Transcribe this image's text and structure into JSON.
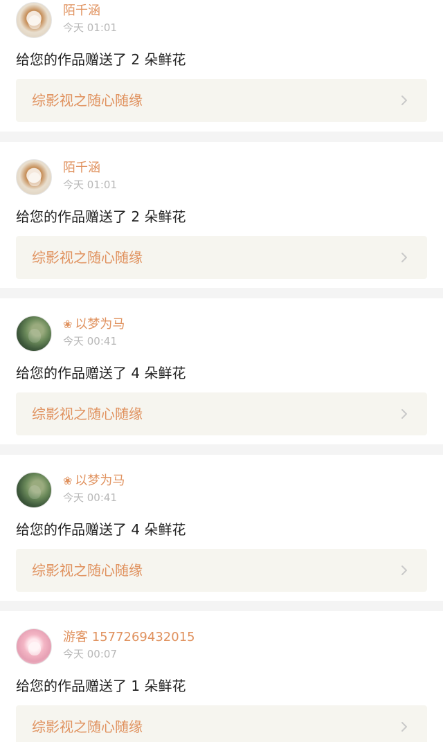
{
  "notifications": [
    {
      "user": "陌千涵",
      "vip": false,
      "time": "今天 01:01",
      "message": "给您的作品赠送了 2 朵鲜花",
      "work_title": "综影视之随心随缘",
      "avatar": "avatar-blonde-girl"
    },
    {
      "user": "陌千涵",
      "vip": false,
      "time": "今天 01:01",
      "message": "给您的作品赠送了 2 朵鲜花",
      "work_title": "综影视之随心随缘",
      "avatar": "avatar-blonde-girl"
    },
    {
      "user": "以梦为马",
      "vip": true,
      "time": "今天 00:41",
      "message": "给您的作品赠送了 4 朵鲜花",
      "work_title": "综影视之随心随缘",
      "avatar": "avatar-nature-scene"
    },
    {
      "user": "以梦为马",
      "vip": true,
      "time": "今天 00:41",
      "message": "给您的作品赠送了 4 朵鲜花",
      "work_title": "综影视之随心随缘",
      "avatar": "avatar-nature-scene"
    },
    {
      "user": "游客 1577269432015",
      "vip": false,
      "time": "今天 00:07",
      "message": "给您的作品赠送了 1 朵鲜花",
      "work_title": "综影视之随心随缘",
      "avatar": "avatar-pink-anime-girl"
    }
  ],
  "flower_badge_glyph": "❀",
  "colors": {
    "accent": "#e0925f",
    "time": "#b7b7b7",
    "work_bg": "#f6f5ef",
    "page_bg": "#f4f4f4"
  }
}
